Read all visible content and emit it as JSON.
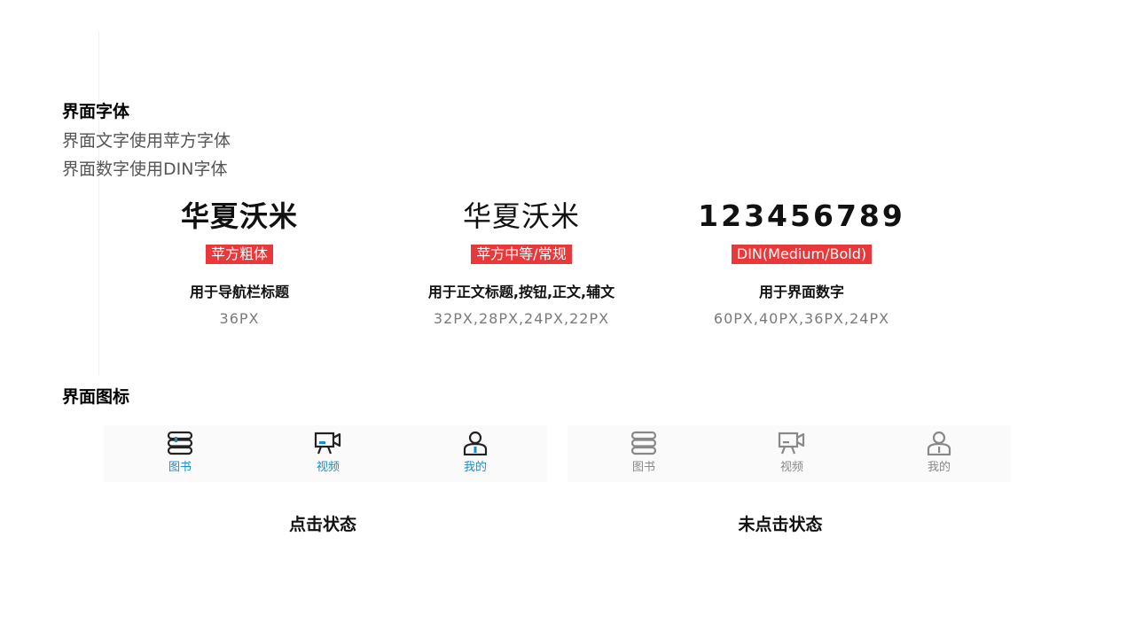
{
  "fonts_section": {
    "title": "界面字体",
    "desc1": "界面文字使用苹方字体",
    "desc2": "界面数字使用DIN字体"
  },
  "samples": [
    {
      "sample": "华夏沃米",
      "tag": "苹方粗体",
      "usage": "用于导航栏标题",
      "sizes": "36PX"
    },
    {
      "sample": "华夏沃米",
      "tag": "苹方中等/常规",
      "usage": "用于正文标题,按钮,正文,辅文",
      "sizes": "32PX,28PX,24PX,22PX"
    },
    {
      "sample": "123456789",
      "tag": "DIN(Medium/Bold)",
      "usage": "用于界面数字",
      "sizes": "60PX,40PX,36PX,24PX"
    }
  ],
  "icons_section": {
    "title": "界面图标"
  },
  "tabs": {
    "books": "图书",
    "video": "视频",
    "mine": "我的"
  },
  "states": {
    "clicked": "点击状态",
    "unclicked": "未点击状态"
  },
  "colors": {
    "tag_bg": "#e8383a",
    "active_accent": "#1a8fc0",
    "inactive": "#888888"
  }
}
